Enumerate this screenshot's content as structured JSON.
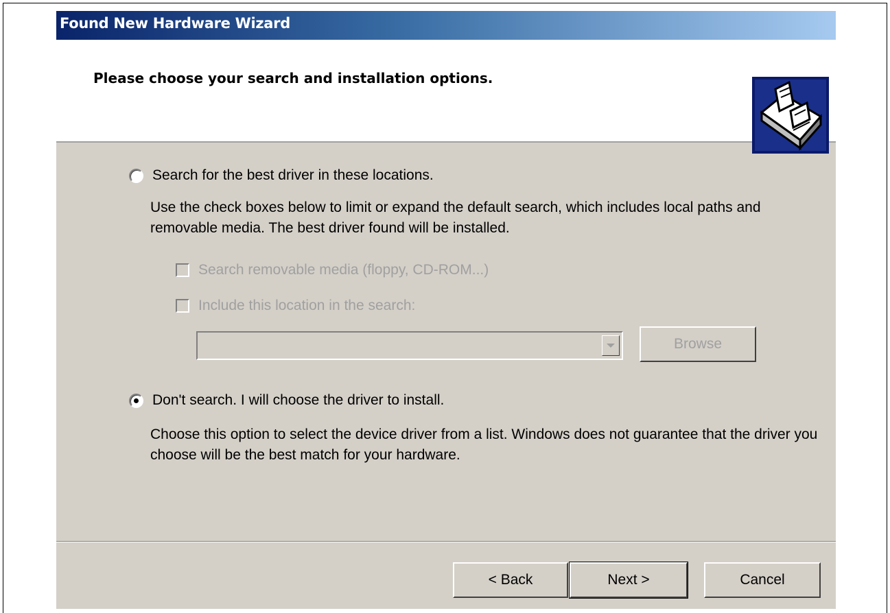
{
  "window": {
    "title": "Found New Hardware Wizard"
  },
  "header": {
    "title": "Please choose your search and installation options.",
    "icon": "hardware-wizard-icon"
  },
  "options": {
    "search": {
      "label": "Search for the best driver in these locations.",
      "checked": false,
      "description": "Use the check boxes below to limit or expand the default search, which includes local paths and removable media. The best driver found will be installed.",
      "removable_media_label": "Search removable media (floppy, CD-ROM...)",
      "removable_media_checked": false,
      "include_location_label": "Include this location in the search:",
      "include_location_checked": false,
      "location_value": "",
      "browse_label": "Browse"
    },
    "dont_search": {
      "label": "Don't search. I will choose the driver to install.",
      "checked": true,
      "description": "Choose this option to select the device driver from a list.  Windows does not guarantee that the driver you choose will be the best match for your hardware."
    }
  },
  "footer": {
    "back_label": "< Back",
    "next_label": "Next >",
    "cancel_label": "Cancel"
  },
  "colors": {
    "titlebar_start": "#0a246a",
    "titlebar_end": "#a6caf0",
    "dialog_face": "#d4d0c8",
    "disabled_text": "#a0a0a0"
  }
}
